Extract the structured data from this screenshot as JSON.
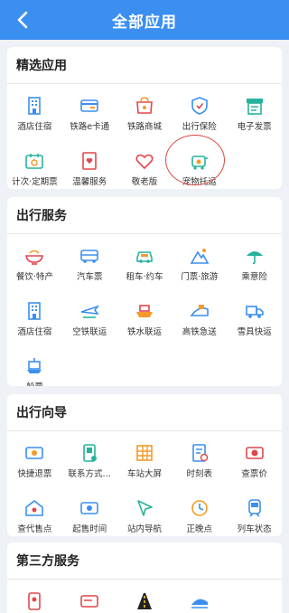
{
  "header": {
    "title": "全部应用"
  },
  "sections": [
    {
      "id": "featured",
      "title": "精选应用",
      "items": [
        {
          "label": "酒店住宿",
          "icon": "hotel-icon"
        },
        {
          "label": "铁路e卡通",
          "icon": "rail-card-icon"
        },
        {
          "label": "铁路商城",
          "icon": "shop-icon"
        },
        {
          "label": "出行保险",
          "icon": "insurance-icon"
        },
        {
          "label": "电子发票",
          "icon": "invoice-icon"
        },
        {
          "label": "计次·定期票",
          "icon": "season-ticket-icon"
        },
        {
          "label": "温馨服务",
          "icon": "care-service-icon"
        },
        {
          "label": "敬老版",
          "icon": "heart-icon"
        },
        {
          "label": "宠物托运",
          "icon": "pet-transport-icon"
        }
      ]
    },
    {
      "id": "travel",
      "title": "出行服务",
      "items": [
        {
          "label": "餐饮·特产",
          "icon": "food-icon"
        },
        {
          "label": "汽车票",
          "icon": "bus-icon"
        },
        {
          "label": "租车·约车",
          "icon": "car-icon"
        },
        {
          "label": "门票·旅游",
          "icon": "mountain-icon"
        },
        {
          "label": "乘意险",
          "icon": "umbrella-icon"
        },
        {
          "label": "酒店住宿",
          "icon": "hotel-icon"
        },
        {
          "label": "空铁联运",
          "icon": "plane-icon"
        },
        {
          "label": "铁水联运",
          "icon": "ship-icon"
        },
        {
          "label": "高铁急送",
          "icon": "express-icon"
        },
        {
          "label": "雪具快运",
          "icon": "truck-icon"
        },
        {
          "label": "船票",
          "icon": "boat-ticket-icon"
        }
      ]
    },
    {
      "id": "guide",
      "title": "出行向导",
      "items": [
        {
          "label": "快捷退票",
          "icon": "refund-icon"
        },
        {
          "label": "联系方式…",
          "icon": "contact-icon"
        },
        {
          "label": "车站大屏",
          "icon": "screen-icon"
        },
        {
          "label": "时刻表",
          "icon": "timetable-icon"
        },
        {
          "label": "查票价",
          "icon": "price-icon"
        },
        {
          "label": "查代售点",
          "icon": "agency-icon"
        },
        {
          "label": "起售时间",
          "icon": "sale-time-icon"
        },
        {
          "label": "站内导航",
          "icon": "navigation-icon"
        },
        {
          "label": "正晚点",
          "icon": "clock-icon"
        },
        {
          "label": "列车状态",
          "icon": "train-icon"
        }
      ]
    },
    {
      "id": "third",
      "title": "第三方服务",
      "items": [
        {
          "label": "",
          "icon": "phone-icon"
        },
        {
          "label": "",
          "icon": "card-icon"
        },
        {
          "label": "",
          "icon": "road-icon"
        },
        {
          "label": "",
          "icon": "highspeed-train-icon"
        }
      ]
    }
  ],
  "colors": {
    "header": "#3b8ff0",
    "icon_blue": "#3b8ff0",
    "icon_green": "#27b39b",
    "icon_red": "#e0474c",
    "icon_orange": "#f39a2b",
    "highlight": "#d9473f"
  }
}
